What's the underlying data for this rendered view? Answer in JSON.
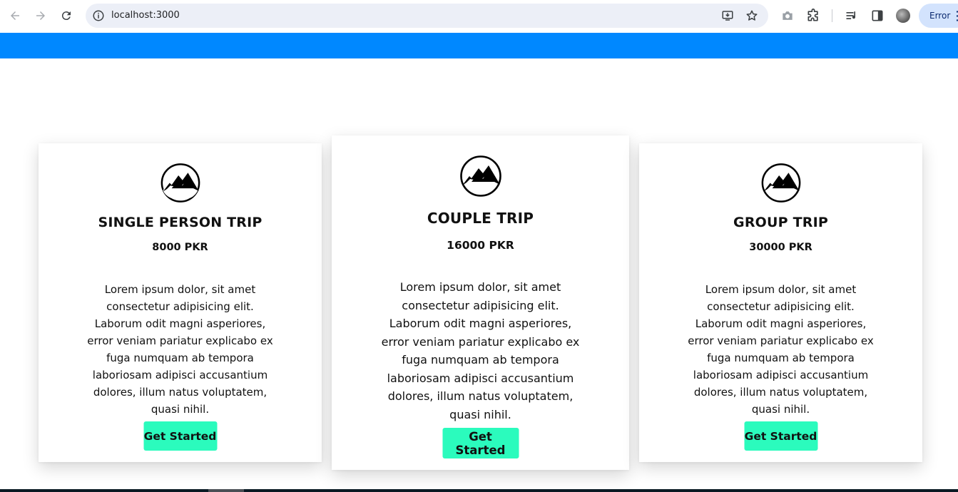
{
  "browser": {
    "url": "localhost:3000",
    "profile_status": "Error"
  },
  "colors": {
    "topbar": "#0088ff",
    "button": "#2bfbbd"
  },
  "cards": [
    {
      "icon": "mountain-icon",
      "title": "SINGLE PERSON TRIP",
      "price": "8000 PKR",
      "description": "Lorem ipsum dolor, sit amet consectetur adipisicing elit. Laborum odit magni asperiores, error veniam pariatur explicabo ex fuga numquam ab tempora laboriosam adipisci accusantium dolores, illum natus voluptatem, quasi nihil.",
      "button": "Get Started"
    },
    {
      "icon": "mountain-icon",
      "title": "COUPLE TRIP",
      "price": "16000 PKR",
      "description": "Lorem ipsum dolor, sit amet consectetur adipisicing elit. Laborum odit magni asperiores, error veniam pariatur explicabo ex fuga numquam ab tempora laboriosam adipisci accusantium dolores, illum natus voluptatem, quasi nihil.",
      "button": "Get Started"
    },
    {
      "icon": "mountain-icon",
      "title": "GROUP TRIP",
      "price": "30000 PKR",
      "description": "Lorem ipsum dolor, sit amet consectetur adipisicing elit. Laborum odit magni asperiores, error veniam pariatur explicabo ex fuga numquam ab tempora laboriosam adipisci accusantium dolores, illum natus voluptatem, quasi nihil.",
      "button": "Get Started"
    }
  ]
}
